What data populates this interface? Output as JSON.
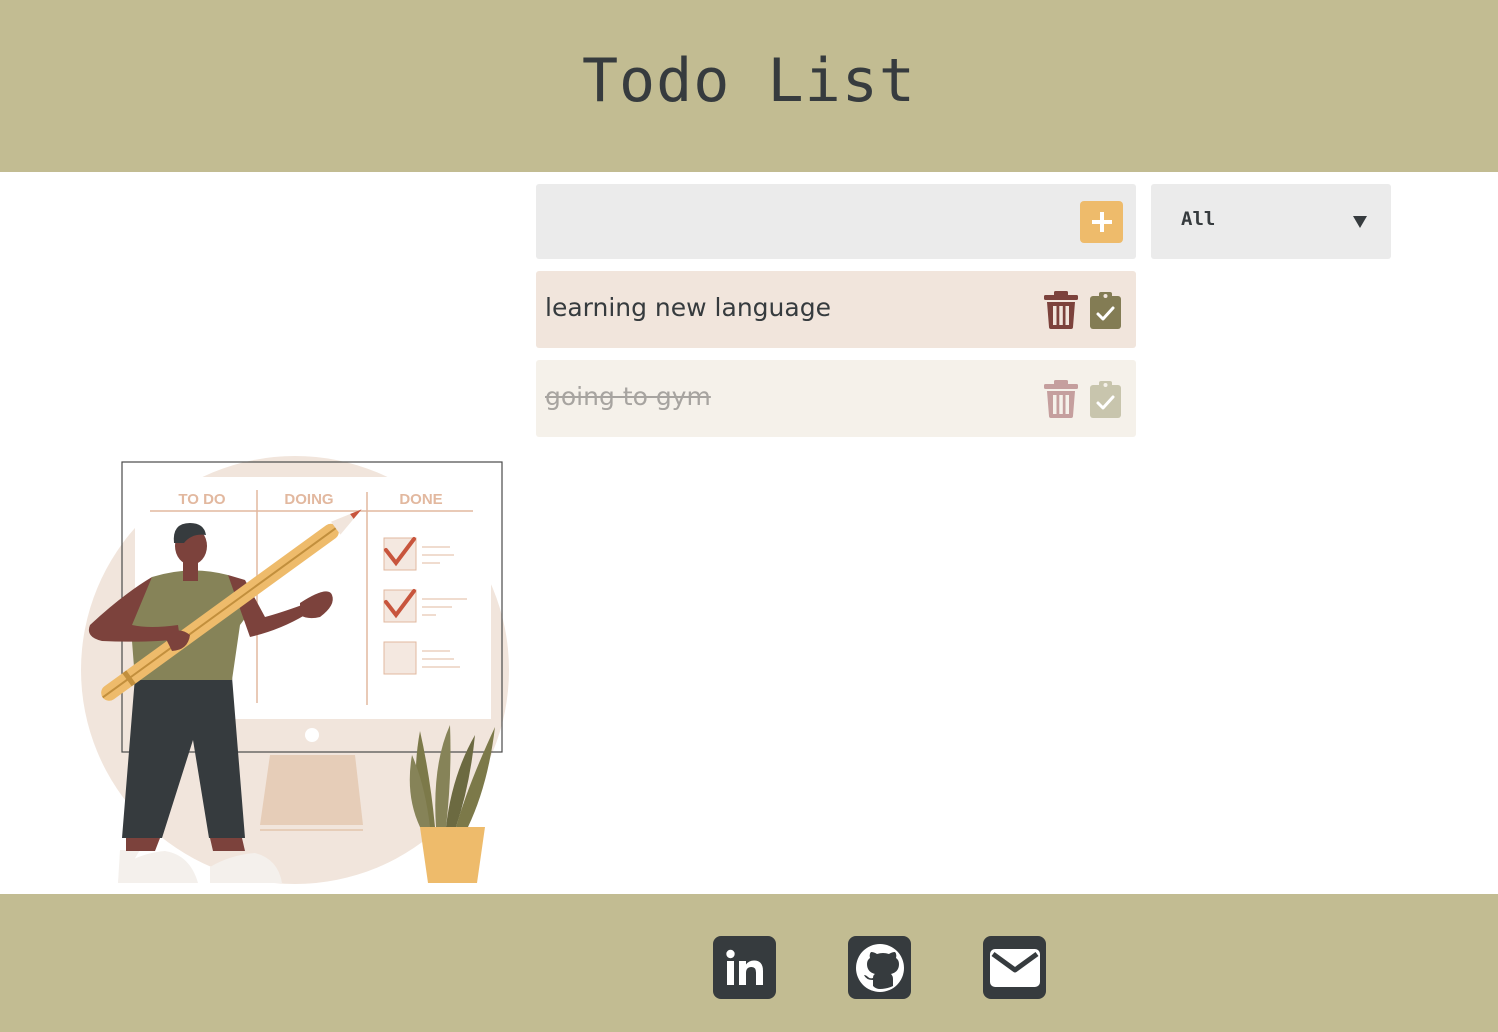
{
  "header": {
    "title": "Todo List"
  },
  "input": {
    "value": "",
    "placeholder": ""
  },
  "add_button": {
    "icon": "plus-icon"
  },
  "filter": {
    "selected": "All",
    "icon": "triangle-down-icon"
  },
  "todos": [
    {
      "text": "learning new language",
      "completed": false
    },
    {
      "text": "going to gym",
      "completed": true
    }
  ],
  "illustration": {
    "columns": [
      "TO DO",
      "DOING",
      "DONE"
    ]
  },
  "footer": {
    "links": [
      {
        "name": "LinkedIn",
        "icon": "linkedin-icon"
      },
      {
        "name": "GitHub",
        "icon": "github-icon"
      },
      {
        "name": "Email",
        "icon": "envelope-icon"
      }
    ]
  },
  "colors": {
    "header_bg": "#c2bc92",
    "text_dark": "#363b3e",
    "accent_orange": "#eebb6b",
    "trash": "#7c423c",
    "check": "#837c54"
  }
}
